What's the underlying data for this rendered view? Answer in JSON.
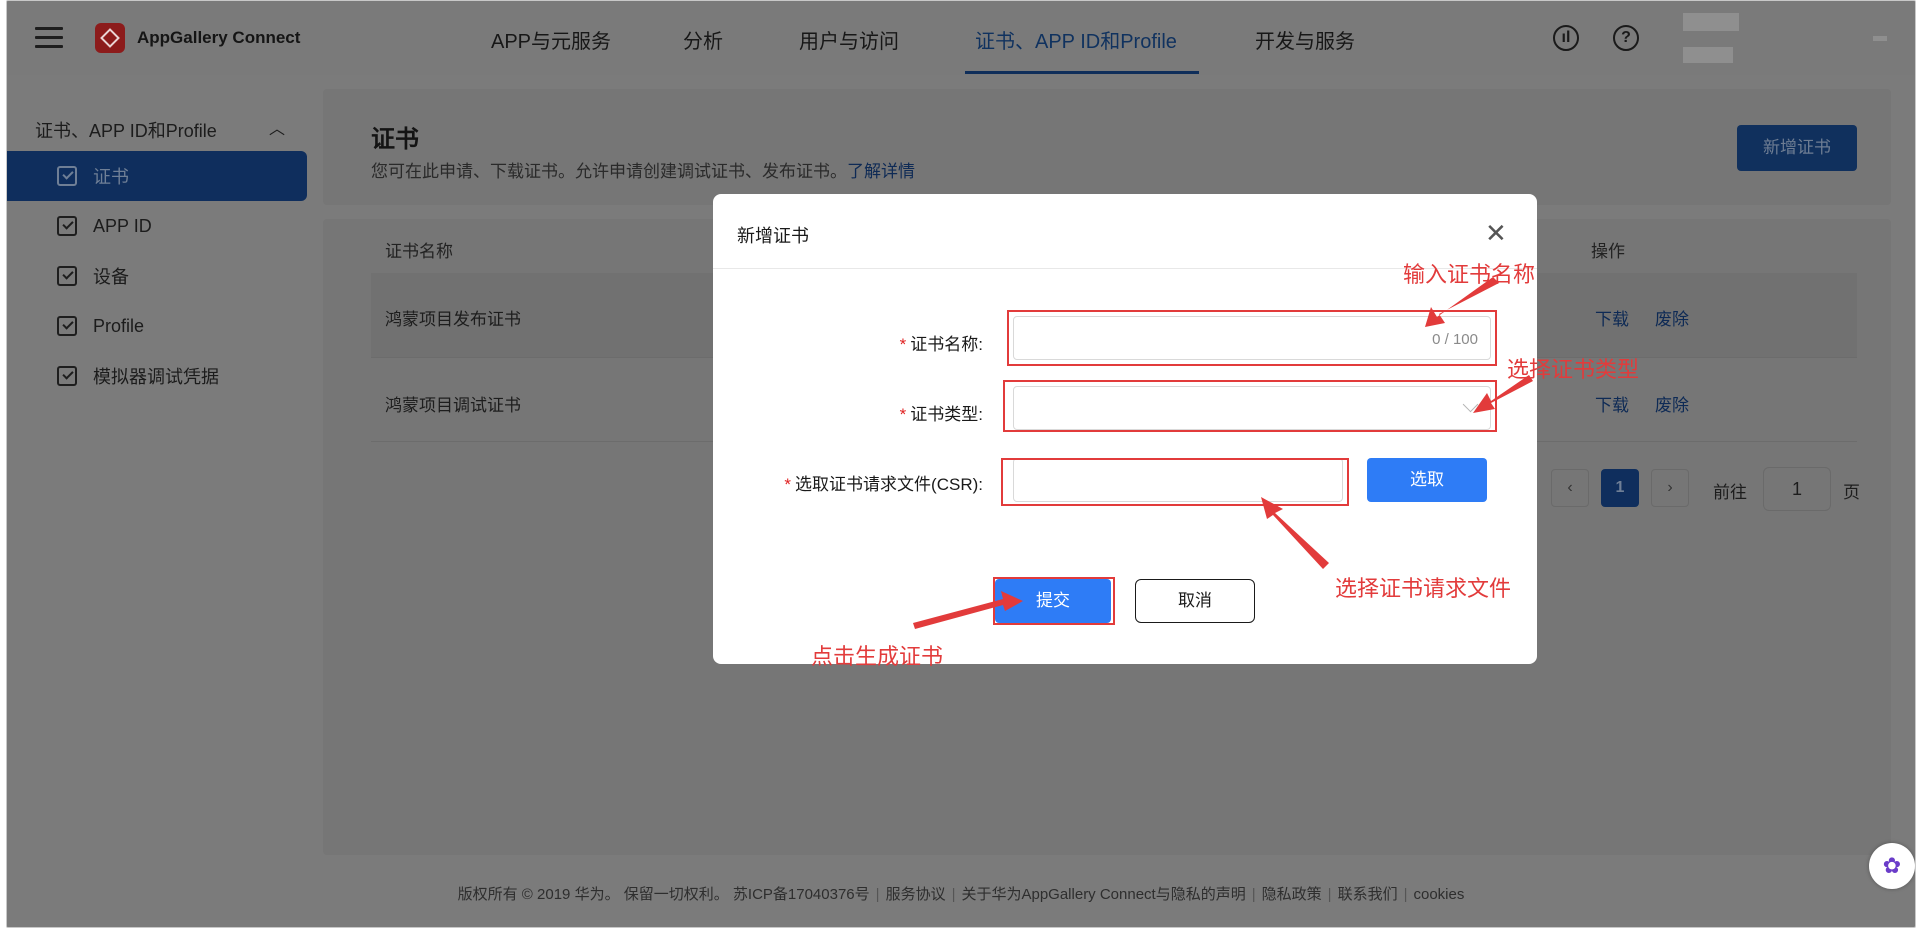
{
  "app": {
    "name": "AppGallery Connect"
  },
  "nav": {
    "tabs": [
      {
        "label": "APP与元服务"
      },
      {
        "label": "分析"
      },
      {
        "label": "用户与访问"
      },
      {
        "label": "证书、APP ID和Profile"
      },
      {
        "label": "开发与服务"
      }
    ],
    "active_index": 3
  },
  "sidebar": {
    "group_label": "证书、APP ID和Profile",
    "items": [
      {
        "label": "证书"
      },
      {
        "label": "APP ID"
      },
      {
        "label": "设备"
      },
      {
        "label": "Profile"
      },
      {
        "label": "模拟器调试凭据"
      }
    ],
    "active_index": 0
  },
  "page": {
    "title": "证书",
    "description": "您可在此申请、下载证书。允许申请创建调试证书、发布证书。",
    "learn_more": "了解详情",
    "new_button": "新增证书"
  },
  "table": {
    "columns": [
      "证书名称",
      "操作"
    ],
    "rows": [
      {
        "name": "鸿蒙项目发布证书",
        "actions": [
          "下载",
          "废除"
        ]
      },
      {
        "name": "鸿蒙项目调试证书",
        "actions": [
          "下载",
          "废除"
        ]
      }
    ]
  },
  "pagination": {
    "current": "1",
    "goto_label": "前往",
    "goto_value": "1",
    "page_suffix": "页"
  },
  "footer": {
    "copyright": "版权所有 © 2019 华为。 保留一切权利。 苏ICP备17040376号",
    "links": [
      "服务协议",
      "关于华为AppGallery Connect与隐私的声明",
      "隐私政策",
      "联系我们",
      "cookies"
    ]
  },
  "modal": {
    "title": "新增证书",
    "fields": {
      "name_label": "证书名称:",
      "name_value": "",
      "name_counter": "0 / 100",
      "type_label": "证书类型:",
      "type_value": "",
      "csr_label": "选取证书请求文件(CSR):",
      "csr_value": ""
    },
    "choose_button": "选取",
    "submit_button": "提交",
    "cancel_button": "取消"
  },
  "annotations": {
    "name": "输入证书名称",
    "type": "选择证书类型",
    "csr": "选择证书请求文件",
    "submit": "点击生成证书"
  },
  "colors": {
    "annotation": "#e23b3b",
    "primary": "#2e7cf6",
    "required": "#e02020"
  }
}
